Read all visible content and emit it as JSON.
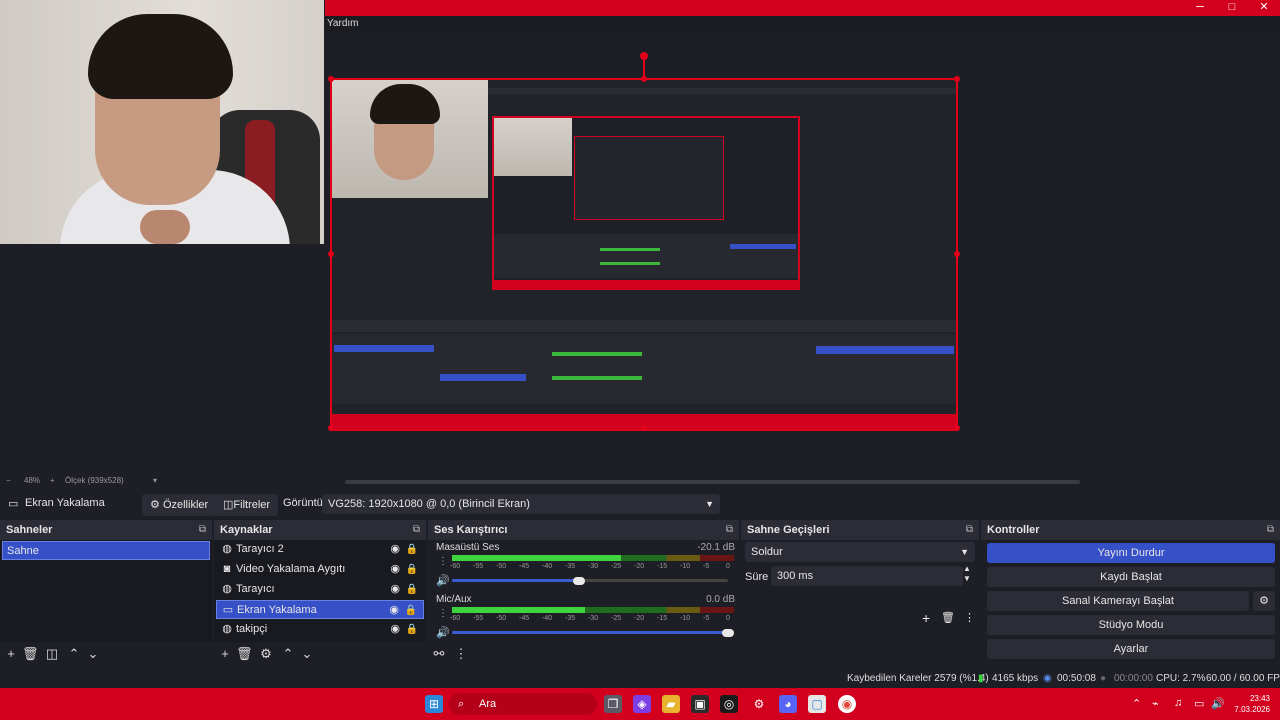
{
  "menu": {
    "help": "Yardım"
  },
  "window_controls": {
    "minimize": "─",
    "maximize": "□",
    "close": "✕"
  },
  "zoom": {
    "minus": "−",
    "percent": "48%",
    "plus": "+",
    "scale": "Ölçek (939x528)",
    "dropdown": "▾"
  },
  "context": {
    "source_name": "Ekran Yakalama",
    "properties": "Özellikler",
    "filters": "Filtreler",
    "display_label": "Görüntü",
    "display_value": "VG258: 1920x1080 @ 0,0 (Birincil Ekran)"
  },
  "scenes": {
    "title": "Sahneler",
    "items": [
      "Sahne"
    ]
  },
  "sources": {
    "title": "Kaynaklar",
    "items": [
      {
        "label": "Tarayıcı 2",
        "icon": "globe-icon"
      },
      {
        "label": "Video Yakalama Aygıtı",
        "icon": "camera-icon"
      },
      {
        "label": "Tarayıcı",
        "icon": "globe-icon"
      },
      {
        "label": "Ekran Yakalama",
        "icon": "monitor-icon"
      },
      {
        "label": "takipçi",
        "icon": "globe-icon"
      }
    ]
  },
  "mixer": {
    "title": "Ses Karıştırıcı",
    "channels": [
      {
        "name": "Masaüstü Ses",
        "db": "-20.1 dB",
        "level": 0.6,
        "volume": 0.46
      },
      {
        "name": "Mic/Aux",
        "db": "0.0 dB",
        "level": 0.47,
        "volume": 1.0
      }
    ],
    "scale": [
      "-60",
      "-55",
      "-50",
      "-45",
      "-40",
      "-35",
      "-30",
      "-25",
      "-20",
      "-15",
      "-10",
      "-5",
      "0"
    ]
  },
  "transitions": {
    "title": "Sahne Geçişleri",
    "selected": "Soldur",
    "duration_label": "Süre",
    "duration_value": "300 ms"
  },
  "controls": {
    "title": "Kontroller",
    "stop_stream": "Yayını Durdur",
    "start_record": "Kaydı Başlat",
    "start_virtualcam": "Sanal Kamerayı Başlat",
    "studio_mode": "Stüdyo Modu",
    "settings": "Ayarlar"
  },
  "status": {
    "dropped_frames": "Kaybedilen Kareler 2579 (%1.4)",
    "bitrate": "4165 kbps",
    "stream_time": "00:50:08",
    "record_time": "00:00:00",
    "cpu": "CPU: 2.7%",
    "fps": "60.00 / 60.00 FPS"
  },
  "taskbar": {
    "search": "Ara",
    "time": "23:43",
    "date": "7.03.2026"
  },
  "colors": {
    "accent": "#3650c8",
    "taskbar": "#d2001e",
    "selection_border": "#e3001b"
  }
}
